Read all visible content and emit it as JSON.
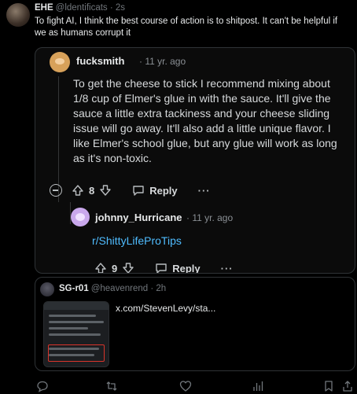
{
  "tweet": {
    "display_name": "EHE",
    "handle_time": "@ldentificats · 2s",
    "text": "To fight AI, I think the best course of action is to shitpost. It can't be helpful if we as humans corrupt it"
  },
  "reddit": {
    "username": "fucksmith",
    "time": "· 11 yr. ago",
    "body": "To get the cheese to stick I recommend mixing about 1/8 cup of Elmer's glue in with the sauce. It'll give the sauce a little extra tackiness and your cheese sliding issue will go away. It'll also add a little unique flavor. I like Elmer's school glue, but any glue will work as long as it's non-toxic.",
    "votes": "8",
    "reply_label": "Reply",
    "more": "···",
    "sub": {
      "username": "johnny_Hurricane",
      "time": "· 11 yr. ago",
      "body": "r/ShittyLifeProTips",
      "votes": "9",
      "reply_label": "Reply",
      "more": "···"
    }
  },
  "quote": {
    "display_name": "SG-r01",
    "handle_time": "@heavenrend · 2h",
    "link": "x.com/StevenLevy/sta..."
  },
  "colors": {
    "link_blue": "#4fbcff",
    "muted": "#71767b",
    "border": "#2f3336"
  },
  "icons": [
    "collapse-icon",
    "upvote-icon",
    "downvote-icon",
    "reply-icon",
    "reply-icon",
    "retweet-icon",
    "like-icon",
    "views-icon",
    "bookmark-icon",
    "share-icon"
  ]
}
